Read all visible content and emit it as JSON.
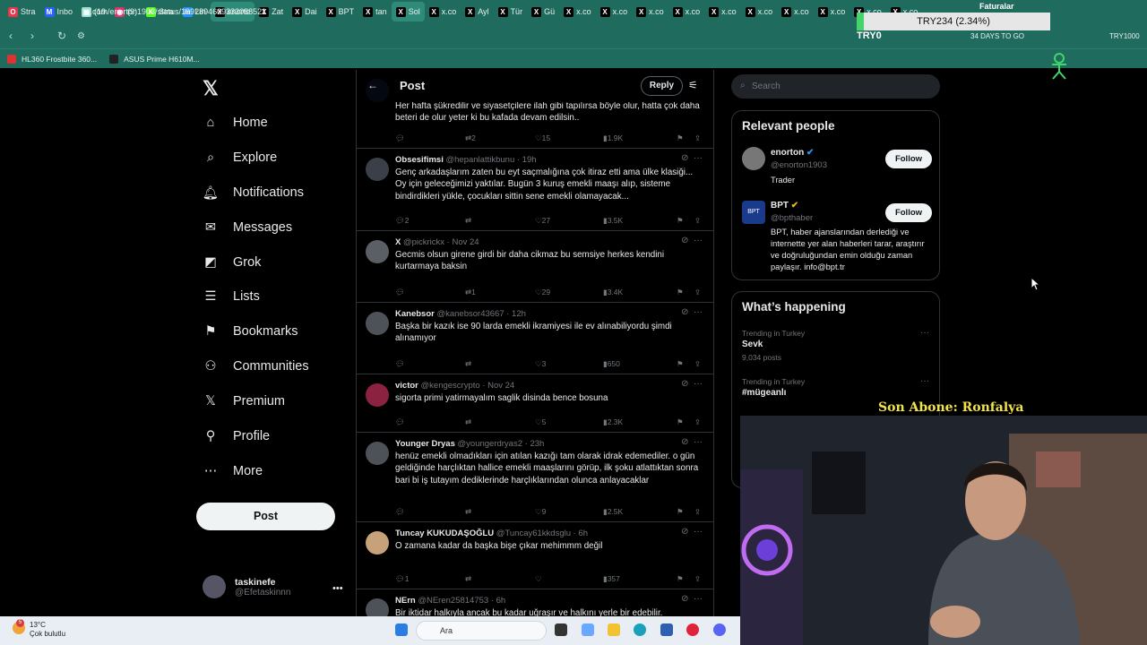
{
  "browser": {
    "tabs": [
      {
        "label": "Stra",
        "color": "#e8364b",
        "glyph": "O"
      },
      {
        "label": "Inbo",
        "color": "#2962ff",
        "glyph": "M"
      },
      {
        "label": "(19",
        "color": "#9be0cf",
        "glyph": "▣"
      },
      {
        "label": "(9)",
        "color": "#e1306c",
        "glyph": "◉"
      },
      {
        "label": "Stra",
        "color": "#53fc18",
        "glyph": "K"
      },
      {
        "label": "Lin",
        "color": "#1e90ff",
        "glyph": "in"
      },
      {
        "label": "enorto",
        "color": "#000000",
        "glyph": "X",
        "active": true
      },
      {
        "label": "Zat",
        "color": "#000000",
        "glyph": "X"
      },
      {
        "label": "Dai",
        "color": "#000000",
        "glyph": "X"
      },
      {
        "label": "BPT",
        "color": "#000000",
        "glyph": "X"
      },
      {
        "label": "tan",
        "color": "#000000",
        "glyph": "X"
      },
      {
        "label": "Sol",
        "color": "#000000",
        "glyph": "X",
        "active": true
      },
      {
        "label": "x.co",
        "color": "#000000",
        "glyph": "X"
      },
      {
        "label": "Ayl",
        "color": "#000000",
        "glyph": "X"
      },
      {
        "label": "Tür",
        "color": "#000000",
        "glyph": "X"
      },
      {
        "label": "Gü",
        "color": "#000000",
        "glyph": "X"
      },
      {
        "label": "x.co",
        "color": "#000000",
        "glyph": "X"
      },
      {
        "label": "x.co",
        "color": "#000000",
        "glyph": "X"
      },
      {
        "label": "x.co",
        "color": "#000000",
        "glyph": "X"
      },
      {
        "label": "x.co",
        "color": "#000000",
        "glyph": "X"
      },
      {
        "label": "x.co",
        "color": "#000000",
        "glyph": "X"
      },
      {
        "label": "x.co",
        "color": "#000000",
        "glyph": "X"
      },
      {
        "label": "x.co",
        "color": "#000000",
        "glyph": "X"
      },
      {
        "label": "x.co",
        "color": "#000000",
        "glyph": "X"
      },
      {
        "label": "x.co",
        "color": "#000000",
        "glyph": "X"
      },
      {
        "label": "x.co",
        "color": "#000000",
        "glyph": "X"
      }
    ],
    "url": "x.com/enorton1903/status/1992894609333088521",
    "bookmarks": [
      {
        "label": "HL360 Frostbite 360..."
      },
      {
        "label": "ASUS Prime H610M..."
      }
    ],
    "chrome_color": "#1f6b5d"
  },
  "overlay": {
    "ticker": "TRY234 (2.34%)",
    "ticker_label": "TRY0",
    "days_to_go": "34 DAYS TO GO",
    "ticker_right": "TRY1000",
    "faturalar": "Faturalar",
    "son_abone": "Son Abone: Ronfalya"
  },
  "nav": {
    "items": [
      {
        "label": "Home",
        "icon": "home-icon"
      },
      {
        "label": "Explore",
        "icon": "search-icon"
      },
      {
        "label": "Notifications",
        "icon": "bell-icon"
      },
      {
        "label": "Messages",
        "icon": "envelope-icon"
      },
      {
        "label": "Grok",
        "icon": "grok-icon"
      },
      {
        "label": "Lists",
        "icon": "list-icon"
      },
      {
        "label": "Bookmarks",
        "icon": "bookmark-icon"
      },
      {
        "label": "Communities",
        "icon": "communities-icon"
      },
      {
        "label": "Premium",
        "icon": "x-icon"
      },
      {
        "label": "Profile",
        "icon": "person-icon"
      },
      {
        "label": "More",
        "icon": "more-circle-icon"
      }
    ],
    "post_button": "Post",
    "account": {
      "name": "taskinefe",
      "handle": "@Efetaskinnn"
    }
  },
  "header": {
    "title": "Post",
    "reply_button": "Reply"
  },
  "tweets": [
    {
      "name": "",
      "handle": "",
      "time": "",
      "text": "Her hafta şükredilir ve siyasetçilere ilah gibi tapılırsa böyle olur, hatta çok daha beteri de olur yeter ki bu kafada devam edilsin..",
      "replies": "",
      "reposts": "2",
      "likes": "15",
      "views": "1.9K"
    },
    {
      "name": "Obsesifimsi",
      "handle": "@hepanlattikbunu · 19h",
      "time": "",
      "text": "Genç arkadaşlarım zaten bu eyt saçmalığına çok itiraz etti ama ülke klasiği... Oy için geleceğimizi yaktılar. Bugün 3 kuruş emekli maaşı alıp, sisteme bindirdikleri yükle, çocukları sittin sene emekli olamayacak...",
      "replies": "2",
      "reposts": "",
      "likes": "27",
      "views": "3.5K"
    },
    {
      "name": "X",
      "handle": "@pickrickx · Nov 24",
      "time": "",
      "text": "Gecmis olsun girene girdi bir daha cikmaz bu semsiye herkes kendini kurtarmaya baksin",
      "replies": "",
      "reposts": "1",
      "likes": "29",
      "views": "3.4K"
    },
    {
      "name": "Kanebsor",
      "handle": "@kanebsor43667 · 12h",
      "time": "",
      "text": "Başka bir kazık ise 90 larda emekli ikramiyesi ile ev alınabiliyordu şimdi alınamıyor",
      "replies": "",
      "reposts": "",
      "likes": "3",
      "views": "650"
    },
    {
      "name": "victor",
      "handle": "@kengescrypto · Nov 24",
      "time": "",
      "text": "sigorta primi yatirmayalım saglik disinda bence bosuna",
      "replies": "",
      "reposts": "",
      "likes": "5",
      "views": "2.3K"
    },
    {
      "name": "Younger Dryas",
      "handle": "@youngerdryas2 · 23h",
      "time": "",
      "text": "henüz emekli olmadıkları için atılan kazığı tam olarak idrak edemediler. o gün geldiğinde harçlıktan hallice emekli maaşlarını görüp, ilk şoku atlattıktan sonra bari bi iş tutayım dediklerinde harçlıklarından olunca anlayacaklar",
      "replies": "",
      "reposts": "",
      "likes": "9",
      "views": "2.5K"
    },
    {
      "name": "Tuncay KUKUDAŞOĞLU",
      "handle": "@Tuncay61kkdsglu · 6h",
      "time": "",
      "text": "O zamana kadar da başka bişe çıkar mehimmm değil",
      "replies": "1",
      "reposts": "",
      "likes": "",
      "views": "357"
    },
    {
      "name": "NErn",
      "handle": "@NEren25814753 · 6h",
      "time": "",
      "text": "Bir iktidar halkıyla ancak bu kadar uğraşır ve halkını yerle bir edebilir.",
      "replies": "",
      "reposts": "",
      "likes": "",
      "views": ""
    }
  ],
  "sidebar": {
    "search_placeholder": "Search",
    "relevant": {
      "title": "Relevant people",
      "people": [
        {
          "name": "enorton",
          "handle": "@enorton1903",
          "bio": "Trader",
          "follow": "Follow"
        },
        {
          "name": "BPT",
          "handle": "@bpthaber",
          "bio": "BPT, haber ajanslarından derlediği ve internette yer alan haberleri tarar, araştırır ve doğruluğundan emin olduğu zaman paylaşır. info@bpt.tr",
          "follow": "Follow"
        }
      ]
    },
    "happening": {
      "title": "What’s happening",
      "trends": [
        {
          "location": "Trending in Turkey",
          "topic": "Sevk",
          "count": "9,034 posts"
        },
        {
          "location": "Trending in Turkey",
          "topic": "#mügeanlı",
          "count": ""
        }
      ]
    }
  },
  "taskbar": {
    "weather_temp": "13°C",
    "weather_desc": "Çok bulutlu",
    "search": "Ara",
    "badge": "5"
  }
}
